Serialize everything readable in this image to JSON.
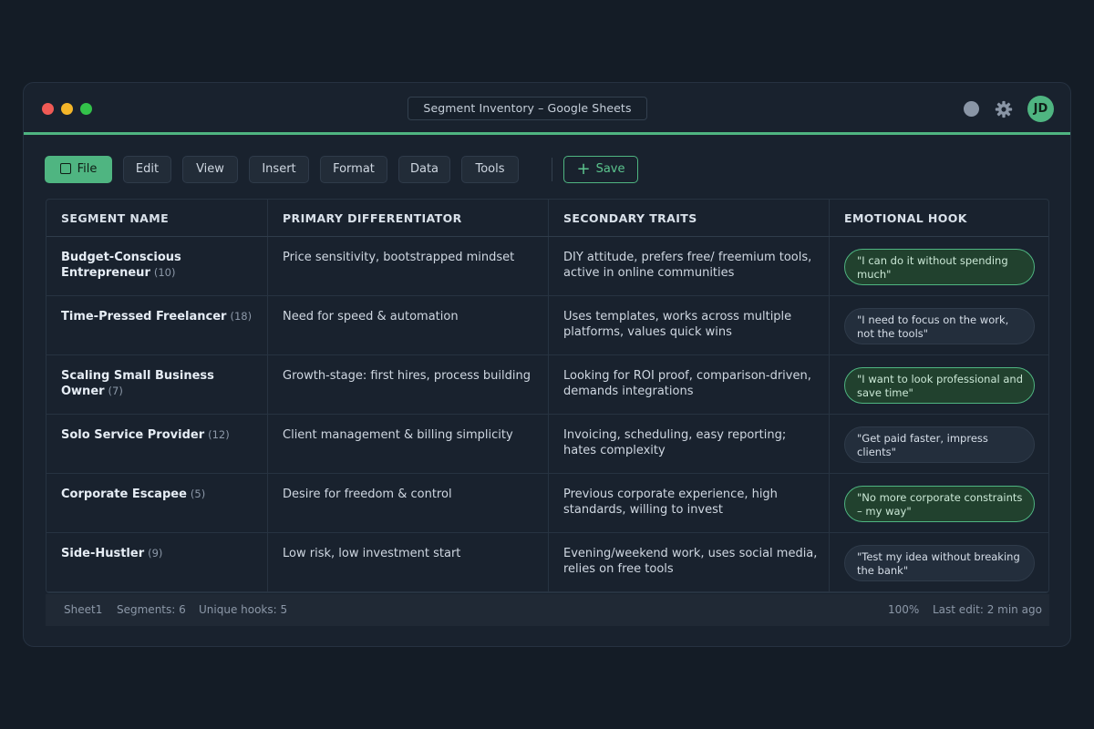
{
  "window": {
    "title": "Segment Inventory – Google Sheets",
    "avatar_initials": "JD"
  },
  "colors": {
    "accent": "#4fb581",
    "background": "#141c26",
    "panel": "#19222e"
  },
  "icons": {
    "record": "circle-icon",
    "settings": "gear-icon"
  },
  "toolbar": {
    "file": "File",
    "edit": "Edit",
    "view": "View",
    "insert": "Insert",
    "format": "Format",
    "data": "Data",
    "tools": "Tools",
    "save": "Save"
  },
  "table": {
    "headers": [
      "SEGMENT NAME",
      "PRIMARY DIFFERENTIATOR",
      "SECONDARY TRAITS",
      "EMOTIONAL HOOK"
    ],
    "rows": [
      {
        "name": "Budget-Conscious Entrepreneur",
        "count": "(10)",
        "differentiator": "Price sensitivity, bootstrapped mindset",
        "traits": "DIY attitude, prefers free/ freemium tools, active in online communities",
        "hook": "\"I can do it without spending much\"",
        "hook_highlighted": true
      },
      {
        "name": "Time-Pressed Freelancer",
        "count": "(18)",
        "differentiator": "Need for speed & automation",
        "traits": "Uses templates, works across multiple platforms, values quick wins",
        "hook": "\"I need to focus on the work, not the tools\"",
        "hook_highlighted": false
      },
      {
        "name": "Scaling Small Business Owner",
        "count": "(7)",
        "differentiator": "Growth-stage: first hires, process building",
        "traits": "Looking for ROI proof, comparison-driven, demands integrations",
        "hook": "\"I want to look professional and save time\"",
        "hook_highlighted": true
      },
      {
        "name": "Solo Service Provider",
        "count": "(12)",
        "differentiator": "Client management & billing simplicity",
        "traits": "Invoicing, scheduling, easy reporting; hates complexity",
        "hook": "\"Get paid faster, impress clients\"",
        "hook_highlighted": false
      },
      {
        "name": "Corporate Escapee",
        "count": "(5)",
        "differentiator": "Desire for freedom & control",
        "traits": "Previous corporate experience, high standards, willing to invest",
        "hook": "\"No more corporate constraints – my way\"",
        "hook_highlighted": true
      },
      {
        "name": "Side-Hustler",
        "count": "(9)",
        "differentiator": "Low risk, low investment start",
        "traits": "Evening/weekend work, uses social media, relies on free tools",
        "hook": "\"Test my idea without breaking the bank\"",
        "hook_highlighted": false
      }
    ]
  },
  "status": {
    "sheet": "Sheet1",
    "segments": "Segments: 6",
    "unique_hooks": "Unique hooks: 5",
    "zoom": "100%",
    "last_edit": "Last edit: 2 min ago"
  }
}
